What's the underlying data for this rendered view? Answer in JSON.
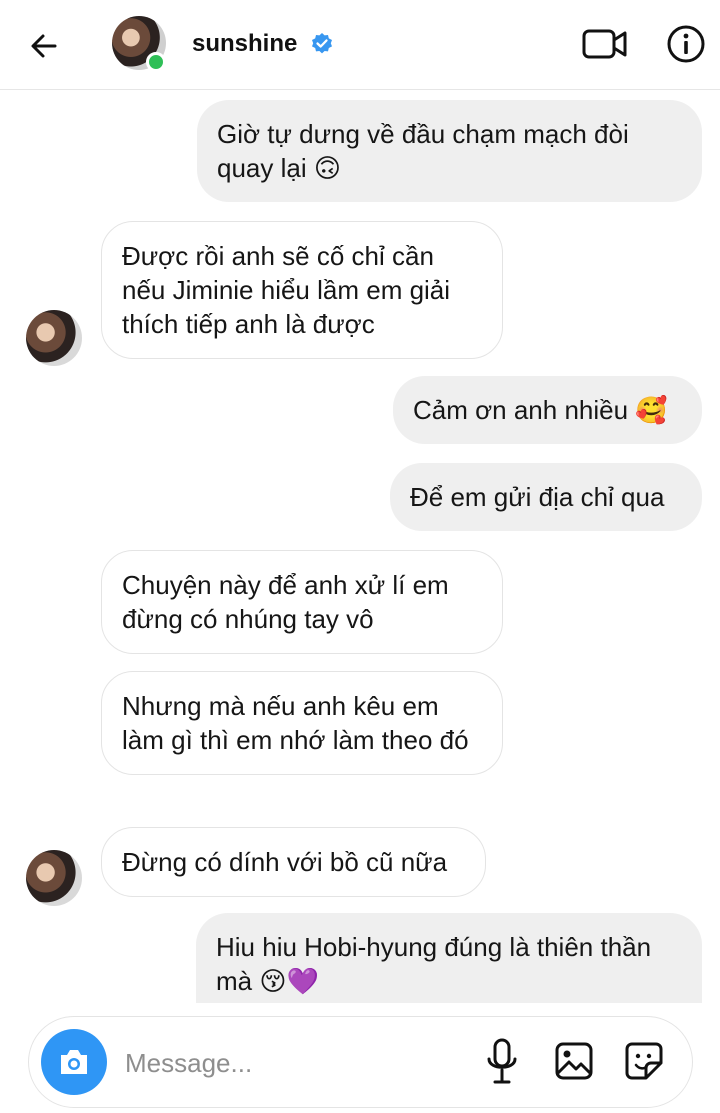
{
  "header": {
    "name": "sunshine",
    "verified": true,
    "icons": [
      "back-arrow-icon",
      "verified-badge-icon",
      "video-call-icon",
      "info-icon"
    ],
    "online_color": "#2fbf57",
    "verified_color": "#3897f0"
  },
  "messages": [
    {
      "direction": "outgoing",
      "text": "Giờ tự dưng về đầu chạm mạch đòi quay lại 🙃"
    },
    {
      "direction": "incoming",
      "text": "Được rồi anh sẽ cố chỉ cần nếu Jiminie hiểu lầm em giải thích tiếp anh là được"
    },
    {
      "direction": "outgoing",
      "text": "Cảm ơn anh nhiều 🥰"
    },
    {
      "direction": "outgoing",
      "text": "Để em gửi địa chỉ qua"
    },
    {
      "direction": "incoming",
      "text": "Chuyện này để anh xử lí em đừng có nhúng tay vô"
    },
    {
      "direction": "incoming",
      "text": "Nhưng mà nếu anh kêu em làm gì thì em nhớ làm theo đó"
    },
    {
      "direction": "incoming",
      "text": "Đừng có dính với bồ cũ nữa"
    },
    {
      "direction": "outgoing",
      "text": "Hiu hiu Hobi-hyung đúng là thiên thần mà 😚💜"
    }
  ],
  "composer": {
    "placeholder": "Message...",
    "icons": [
      "camera-icon",
      "microphone-icon",
      "gallery-icon",
      "sticker-icon"
    ],
    "camera_color": "#2f96f5"
  }
}
